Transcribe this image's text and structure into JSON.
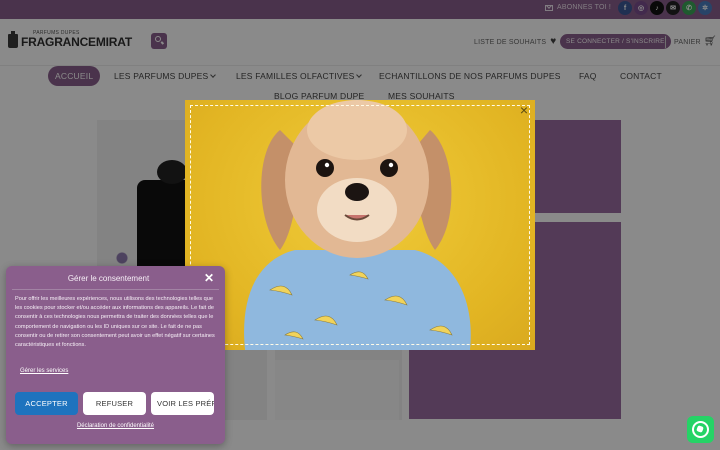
{
  "topbar": {
    "subscribe_label": "ABONNES TOI !",
    "social": [
      {
        "icon": "facebook-icon",
        "glyph": "f",
        "color": "#3b5998"
      },
      {
        "icon": "instagram-icon",
        "glyph": "◎",
        "color": "#7b4e8e"
      },
      {
        "icon": "tiktok-icon",
        "glyph": "♪",
        "color": "#111111"
      },
      {
        "icon": "email-icon",
        "glyph": "✉",
        "color": "#222222"
      },
      {
        "icon": "phone-icon",
        "glyph": "✆",
        "color": "#3aa757"
      },
      {
        "icon": "settings-icon",
        "glyph": "✲",
        "color": "#4a7fc0"
      }
    ]
  },
  "header": {
    "logo_small": "PARFUMS DUPES",
    "logo_big": "FRAGRANCEMIRAT",
    "wishlist_label": "LISTE DE SOUHAITS",
    "connect_label": "SE CONNECTER / S'INSCRIRE",
    "cart_label": "PANIER"
  },
  "nav": {
    "items": [
      {
        "label": "ACCUEIL"
      },
      {
        "label": "LES PARFUMS DUPES"
      },
      {
        "label": "LES FAMILLES OLFACTIVES"
      },
      {
        "label": "ECHANTILLONS DE NOS PARFUMS DUPES"
      },
      {
        "label": "FAQ"
      },
      {
        "label": "CONTACT"
      },
      {
        "label": "BLOG PARFUM DUPE"
      },
      {
        "label": "MES SOUHAITS"
      }
    ]
  },
  "consent": {
    "title": "Gérer le consentement",
    "text": "Pour offrir les meilleures expériences, nous utilisons des technologies telles que les cookies pour stocker et/ou accéder aux informations des appareils. Le fait de consentir à ces technologies nous permettra de traiter des données telles que le comportement de navigation ou les ID uniques sur ce site. Le fait de ne pas consentir ou de retirer son consentement peut avoir un effet négatif sur certaines caractéristiques et fonctions.",
    "manage_link": "Gérer les services",
    "accept": "ACCEPTER",
    "refuse": "REFUSER",
    "prefs": "VOIR LES PRÉFÉRENCES",
    "policy_link": "Déclaration de confidentialité"
  },
  "colors": {
    "brand_purple": "#8a5e8c",
    "accept_blue": "#1e73be",
    "popup_yellow": "#e8c02e",
    "whatsapp_green": "#25d366"
  }
}
